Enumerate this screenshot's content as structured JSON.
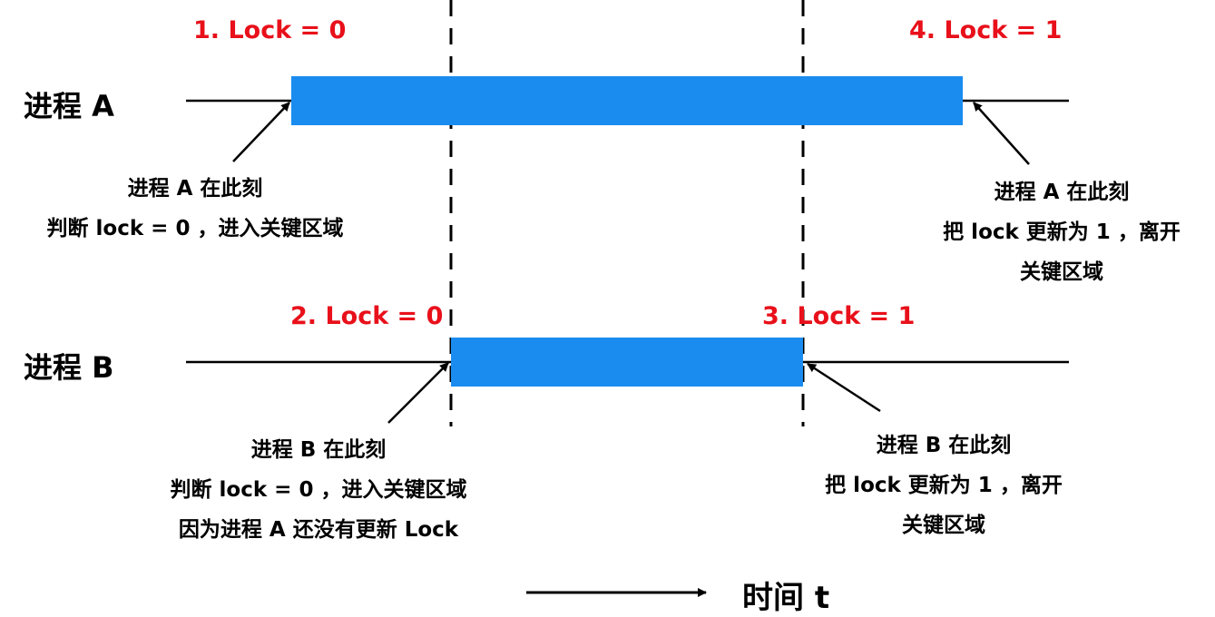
{
  "colors": {
    "bar": "#1a8cf0",
    "lock_text": "#e8101a",
    "line": "#000000"
  },
  "process_a": {
    "label": "进程 A",
    "lock_start": "1. Lock = 0",
    "lock_end": "4. Lock = 1",
    "note_start": [
      "进程 A 在此刻",
      "判断 lock = 0 ，进入关键区域"
    ],
    "note_end": [
      "进程 A 在此刻",
      "把 lock 更新为 1 ，离开",
      "关键区域"
    ]
  },
  "process_b": {
    "label": "进程 B",
    "lock_start": "2. Lock = 0",
    "lock_end": "3. Lock = 1",
    "note_start": [
      "进程 B 在此刻",
      "判断 lock = 0 ，进入关键区域",
      "因为进程 A 还没有更新 Lock"
    ],
    "note_end": [
      "进程 B 在此刻",
      "把 lock 更新为 1 ，离开",
      "关键区域"
    ]
  },
  "time_axis": {
    "label": "时间 t"
  }
}
